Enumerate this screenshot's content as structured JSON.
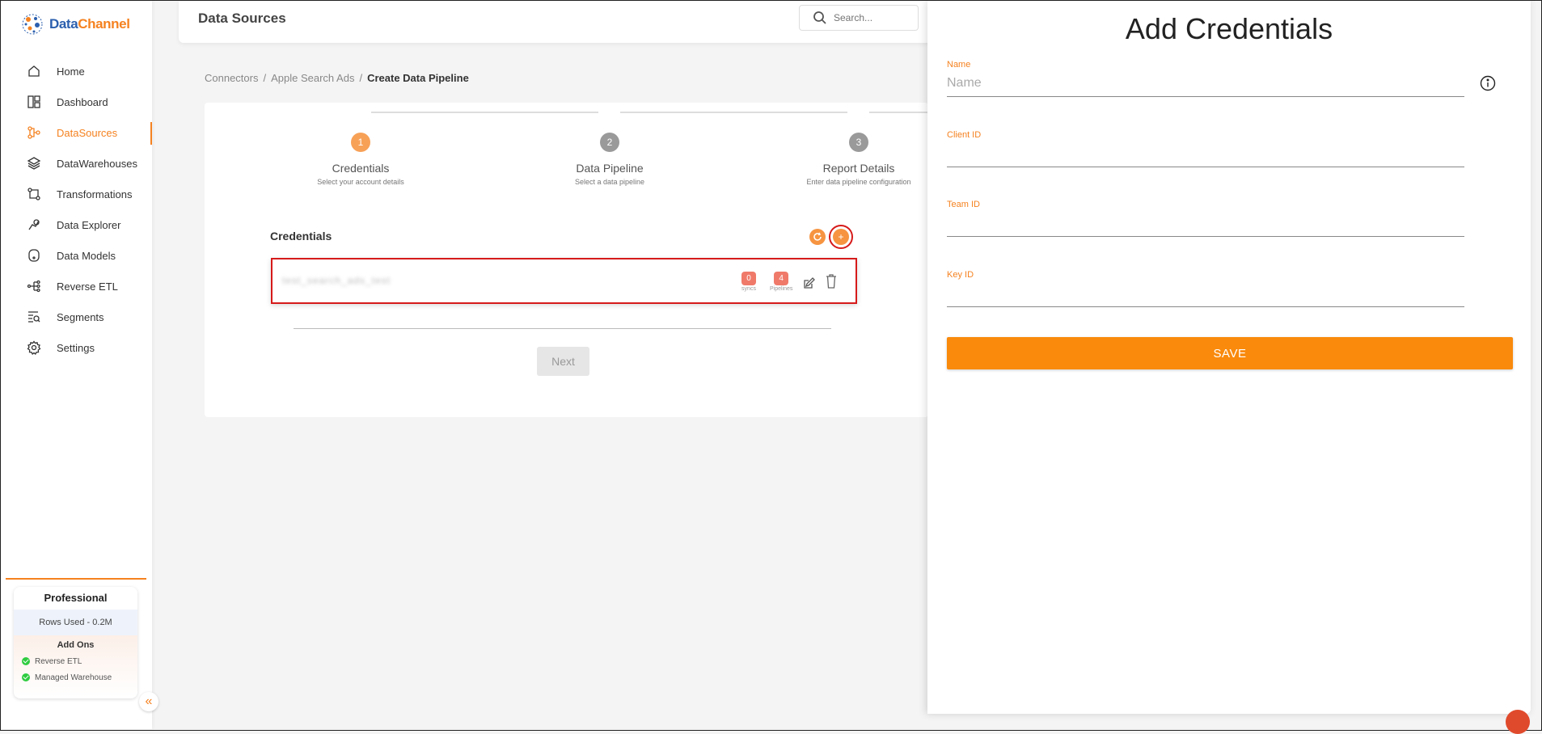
{
  "brand": {
    "name_part1": "Data",
    "name_part2": "Channel"
  },
  "sidebar": {
    "items": [
      {
        "label": "Home",
        "icon": "home-icon",
        "active": false
      },
      {
        "label": "Dashboard",
        "icon": "dashboard-icon",
        "active": false
      },
      {
        "label": "DataSources",
        "icon": "datasources-icon",
        "active": true
      },
      {
        "label": "DataWarehouses",
        "icon": "layers-icon",
        "active": false
      },
      {
        "label": "Transformations",
        "icon": "transform-icon",
        "active": false
      },
      {
        "label": "Data Explorer",
        "icon": "explorer-icon",
        "active": false
      },
      {
        "label": "Data Models",
        "icon": "models-icon",
        "active": false
      },
      {
        "label": "Reverse ETL",
        "icon": "reverse-etl-icon",
        "active": false
      },
      {
        "label": "Segments",
        "icon": "segments-icon",
        "active": false
      },
      {
        "label": "Settings",
        "icon": "settings-icon",
        "active": false
      }
    ],
    "plan": {
      "name": "Professional",
      "rows_used": "Rows Used - 0.2M",
      "addons_title": "Add Ons",
      "addons": [
        "Reverse ETL",
        "Managed Warehouse"
      ]
    },
    "collapse_glyph": "«"
  },
  "header": {
    "title": "Data Sources",
    "search_placeholder": "Search..."
  },
  "breadcrumb": {
    "items": [
      "Connectors",
      "Apple Search Ads"
    ],
    "separator": "/",
    "current": "Create Data Pipeline"
  },
  "stepper": {
    "steps": [
      {
        "num": "1",
        "title": "Credentials",
        "sub": "Select your account details"
      },
      {
        "num": "2",
        "title": "Data Pipeline",
        "sub": "Select a data pipeline"
      },
      {
        "num": "3",
        "title": "Report Details",
        "sub": "Enter data pipeline configuration"
      }
    ]
  },
  "credentials": {
    "title": "Credentials",
    "row": {
      "name": "test_search_ads_test",
      "syncs": "0",
      "syncs_label": "syncs",
      "pipelines": "4",
      "pipelines_label": "Pipelines"
    },
    "next_label": "Next"
  },
  "drawer": {
    "title": "Add Credentials",
    "fields": [
      {
        "label": "Name",
        "placeholder": "Name",
        "value": ""
      },
      {
        "label": "Client ID",
        "placeholder": "",
        "value": ""
      },
      {
        "label": "Team ID",
        "placeholder": "",
        "value": ""
      },
      {
        "label": "Key ID",
        "placeholder": "",
        "value": ""
      }
    ],
    "save_label": "SAVE"
  },
  "colors": {
    "accent": "#f58220",
    "save": "#f98a0c",
    "highlight": "#d61a1a"
  }
}
